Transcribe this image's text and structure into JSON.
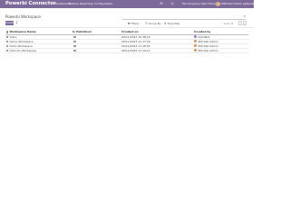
{
  "topbar": {
    "brand": "Powerbi Connector",
    "menus": [
      "Dashboards",
      "History",
      "Reporting",
      "Configuration"
    ],
    "company": "My Company (San Francisco)",
    "user": "Mitchell Admin (gitpod)",
    "icons": [
      "chat-icon",
      "clock-icon"
    ]
  },
  "control": {
    "breadcrumb": "Powerbi Workspace",
    "search_placeholder": "",
    "create_label": "Create",
    "filters_label": "Filters",
    "groupby_label": "Group By",
    "favorites_label": "Favorites",
    "pager": "1-4 / 4"
  },
  "table": {
    "columns": [
      "Workspace Name",
      "Is Published",
      "Created on",
      "Created by"
    ],
    "rows": [
      {
        "name": "Odoo",
        "published": false,
        "created_on": "09/11/2023 10:38:10",
        "created_by": "OdooBot",
        "avatar_color": "#a57ad3"
      },
      {
        "name": "Demo Workspace",
        "published": false,
        "created_on": "09/11/2023 11:17:29",
        "created_by": "Mitchell Admin",
        "avatar_color": "#d9925d"
      },
      {
        "name": "Odoo Workspace",
        "published": false,
        "created_on": "09/11/2023 11:18:03",
        "created_by": "Mitchell Admin",
        "avatar_color": "#d9925d"
      },
      {
        "name": "Odoo Po Workspace",
        "published": false,
        "created_on": "09/11/2023 11:19:13",
        "created_by": "Mitchell Admin",
        "avatar_color": "#d9925d"
      }
    ]
  },
  "colors": {
    "brand": "#7d6a9a"
  }
}
